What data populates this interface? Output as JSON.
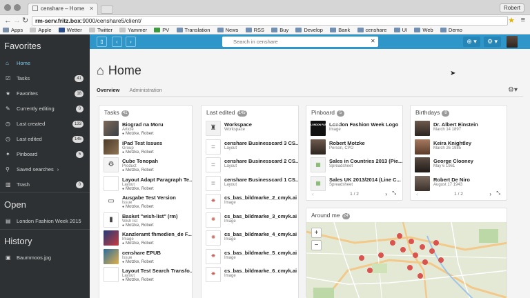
{
  "browser": {
    "tab_title": "censhare – Home",
    "user": "Robert",
    "url_host": "rm-serv.fritz.box",
    "url_path": ":9000/censhare5/client/",
    "bookmarks": [
      "Apps",
      "Apple",
      "Wetter",
      "Twitter",
      "Yammer",
      "PV",
      "Translation",
      "News",
      "RSS",
      "Buy",
      "Develop",
      "Bank",
      "censhare",
      "UI",
      "Web",
      "Demo"
    ]
  },
  "sidebar": {
    "favorites_heading": "Favorites",
    "items": [
      {
        "label": "Home",
        "badge": ""
      },
      {
        "label": "Tasks",
        "badge": "41"
      },
      {
        "label": "Favorites",
        "badge": "18"
      },
      {
        "label": "Currently editing",
        "badge": "0"
      },
      {
        "label": "Last created",
        "badge": "133"
      },
      {
        "label": "Last edited",
        "badge": "145"
      },
      {
        "label": "Pinboard",
        "badge": "5"
      },
      {
        "label": "Saved searches",
        "badge": ""
      },
      {
        "label": "Trash",
        "badge": "0"
      }
    ],
    "open_heading": "Open",
    "open_items": [
      {
        "label": "London Fashion Week 2015"
      }
    ],
    "history_heading": "History",
    "history_items": [
      {
        "label": "Baummoos.jpg"
      }
    ]
  },
  "toolbar": {
    "search_placeholder": "Search in censhare",
    "colors": {
      "toolbar": "#2f96c9",
      "sidebar": "#2d3133",
      "accent": "#7cc7e7"
    }
  },
  "page": {
    "title": "Home",
    "tabs": [
      "Overview",
      "Administration"
    ]
  },
  "tasks": {
    "title": "Tasks",
    "count": "41",
    "items": [
      {
        "title": "Biograd na Moru",
        "type": "Article",
        "owner": "Motzke, Robert"
      },
      {
        "title": "iPad Test Issues",
        "type": "Group",
        "owner": "Motzke, Robert"
      },
      {
        "title": "Cube Tonopah",
        "type": "Product",
        "owner": "Motzke, Robert"
      },
      {
        "title": "Layout Adapt Paragraph Te...",
        "type": "Layout",
        "owner": "Motzke, Robert"
      },
      {
        "title": "Ausgabe Test Version",
        "type": "Issue",
        "owner": "Motzke, Robert"
      },
      {
        "title": "Basket \"wish-list\" (rm)",
        "type": "Wish list",
        "owner": "Motzke, Robert"
      },
      {
        "title": "Kanzleramt fhmedien_de F...",
        "type": "Image",
        "owner": "Motzke, Robert"
      },
      {
        "title": "censhare EPUB",
        "type": "Issue",
        "owner": "Motzke, Robert"
      },
      {
        "title": "Layout Test Search Transfo...",
        "type": "Layout",
        "owner": "Motzke, Robert"
      }
    ]
  },
  "last_edited": {
    "title": "Last edited",
    "count": "145",
    "items": [
      {
        "title": "Workspace",
        "type": "Workspace"
      },
      {
        "title": "censhare Businesscard 3 CS...",
        "type": "Layout"
      },
      {
        "title": "censhare Businesscard 2 CS...",
        "type": "Layout"
      },
      {
        "title": "censhare Businesscard 1 CS...",
        "type": "Layout"
      },
      {
        "title": "cs_bas_bildmarke_2_cmyk.ai",
        "type": "Image"
      },
      {
        "title": "cs_bas_bildmarke_3_cmyk.ai",
        "type": "Image"
      },
      {
        "title": "cs_bas_bildmarke_4_cmyk.ai",
        "type": "Image"
      },
      {
        "title": "cs_bas_bildmarke_5_cmyk.ai",
        "type": "Image"
      },
      {
        "title": "cs_bas_bildmarke_6_cmyk.ai",
        "type": "Image"
      }
    ]
  },
  "pinboard": {
    "title": "Pinboard",
    "count": "5",
    "items": [
      {
        "title": "London Fashion Week Logo",
        "type": "Image",
        "logo_text": "LONDON FASHION WEEK"
      },
      {
        "title": "Robert Motzke",
        "type": "Person, CPO"
      },
      {
        "title": "Sales in Countries 2013 (Pie...",
        "type": "Spreadsheet"
      },
      {
        "title": "Sales UK 2013/2014 (Line C...",
        "type": "Spreadsheet"
      }
    ],
    "pager": "1 / 2"
  },
  "birthdays": {
    "title": "Birthdays",
    "count": "8",
    "items": [
      {
        "name": "Dr. Albert Einstein",
        "date": "March 14 1897"
      },
      {
        "name": "Keira Knightley",
        "date": "March 26 1985"
      },
      {
        "name": "George Clooney",
        "date": "May 6 1961"
      },
      {
        "name": "Robert De Niro",
        "date": "August 17 1943"
      }
    ],
    "pager": "1 / 2"
  },
  "around_me": {
    "title": "Around me",
    "count": "24",
    "zoom_in": "+",
    "zoom_out": "−"
  }
}
